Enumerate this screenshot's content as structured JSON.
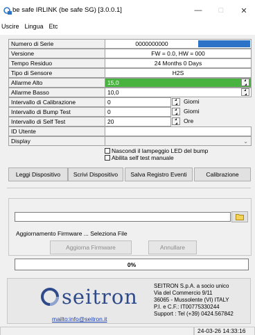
{
  "window": {
    "title": "be safe IRLINK (be safe SG) [3.0.0.1]",
    "minimize": "—",
    "maximize": "□",
    "close": "✕"
  },
  "menu": [
    "Uscire",
    "Lingua",
    "Etc"
  ],
  "properties": {
    "serial": {
      "label": "Numero di Serie",
      "value": "0000000000"
    },
    "version": {
      "label": "Versione",
      "value": "FW = 0.0,    HW = 000"
    },
    "remaining_time": {
      "label": "Tempo Residuo",
      "value": "24 Months 0 Days"
    },
    "sensor_type": {
      "label": "Tipo di Sensore",
      "value": "H2S"
    },
    "alarm_high": {
      "label": "Allarme Alto",
      "value": "15,0"
    },
    "alarm_low": {
      "label": "Allarme Basso",
      "value": "10,0"
    },
    "calibration_interval": {
      "label": "Intervallo di Calibrazione",
      "value": "0",
      "unit": "Giorni"
    },
    "bump_interval": {
      "label": "Intervallo di Bump Test",
      "value": "0",
      "unit": "Giorni"
    },
    "selftest_interval": {
      "label": "Intervallo di Self Test",
      "value": "20",
      "unit": "Ore"
    },
    "user_id": {
      "label": "ID Utente",
      "value": ""
    },
    "display": {
      "label": "Display",
      "value": ""
    }
  },
  "checkboxes": {
    "hide_led": "Nascondi il lampeggio LED del bump",
    "enable_selftest": "Abilita self test manuale"
  },
  "buttons": {
    "read": "Leggi Dispositivo",
    "write": "Scrivi Dispositivo",
    "save_log": "Salva Registro Eventi",
    "calibrate": "Calibrazione",
    "update_fw": "Aggiorna Firmware",
    "cancel": "Annullare"
  },
  "firmware": {
    "file_value": "",
    "status_label": "Aggiornamento Firmware ... Seleziona File",
    "progress_percent": 0,
    "progress_text": "0%"
  },
  "footer": {
    "logo_text": "seitron",
    "mailto": "mailto:info@seitron.it",
    "company_lines": [
      "SEITRON S.p.A. a socio unico",
      "Via del Commercio 9/11",
      "36065 - Mussolente (VI) ITALY",
      "P.I. e C.F.: IT00775330244",
      "Support : Tel (+39) 0424.567842"
    ]
  },
  "status": {
    "datetime": "24-03-26 14:33:16"
  },
  "colors": {
    "accent_blue": "#2c73c7",
    "alarm_green": "#49b33f",
    "logo_blue": "#2f4a8a"
  }
}
